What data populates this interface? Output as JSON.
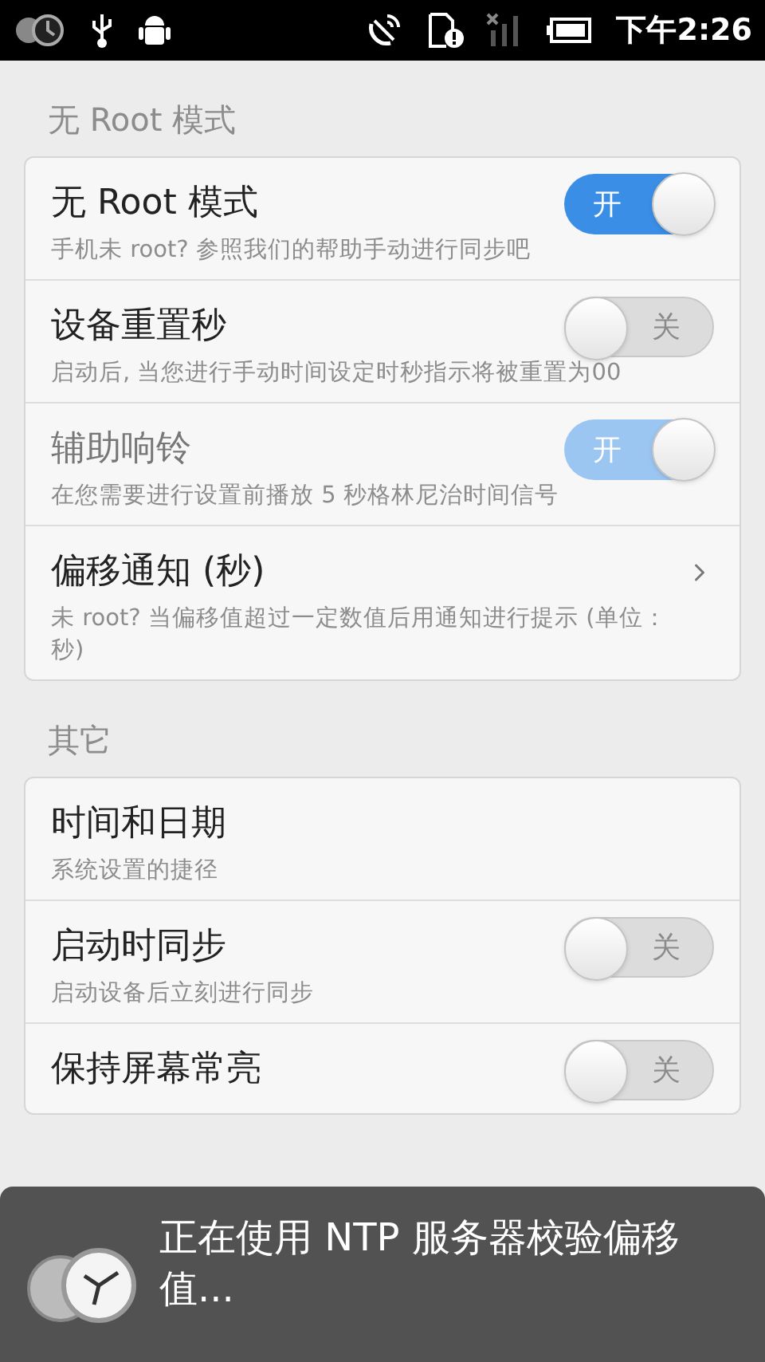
{
  "status_bar": {
    "time": "下午2:26"
  },
  "sections": [
    {
      "header": "无 Root 模式",
      "items": [
        {
          "kind": "switch",
          "title": "无 Root 模式",
          "subtitle": "手机未 root? 参照我们的帮助手动进行同步吧",
          "on": true,
          "disabled": false,
          "switch_label": "开"
        },
        {
          "kind": "switch",
          "title": "设备重置秒",
          "subtitle": "启动后, 当您进行手动时间设定时秒指示将被重置为00",
          "on": false,
          "disabled": false,
          "switch_label": "关"
        },
        {
          "kind": "switch",
          "title": "辅助响铃",
          "subtitle": "在您需要进行设置前播放 5 秒格林尼治时间信号",
          "on": true,
          "disabled": true,
          "switch_label": "开"
        },
        {
          "kind": "link",
          "title": "偏移通知 (秒)",
          "subtitle": "未 root? 当偏移值超过一定数值后用通知进行提示 (单位：秒)",
          "disabled": false
        }
      ]
    },
    {
      "header": "其它",
      "items": [
        {
          "kind": "link_plain",
          "title": "时间和日期",
          "subtitle": "系统设置的捷径",
          "disabled": false
        },
        {
          "kind": "switch",
          "title": "启动时同步",
          "subtitle": "启动设备后立刻进行同步",
          "on": false,
          "disabled": false,
          "switch_label": "关"
        },
        {
          "kind": "switch",
          "title": "保持屏幕常亮",
          "on": false,
          "disabled": false,
          "switch_label": "关"
        }
      ]
    }
  ],
  "toast": {
    "message": "正在使用 NTP 服务器校验偏移值..."
  }
}
